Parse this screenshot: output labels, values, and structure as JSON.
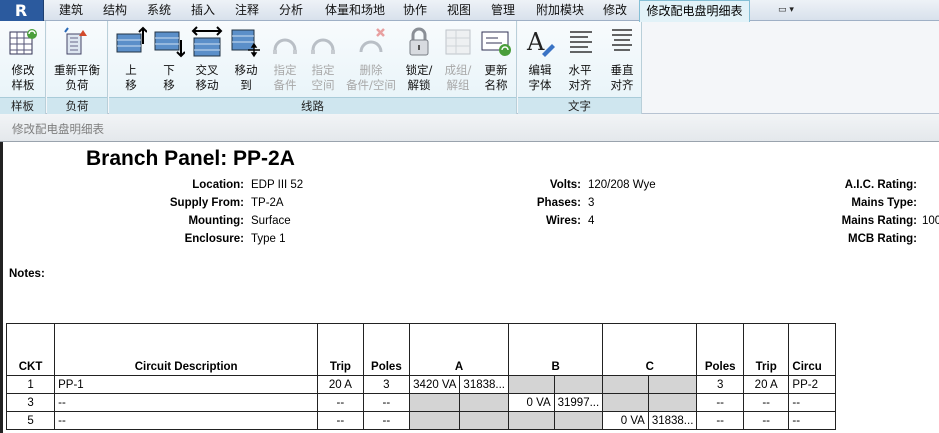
{
  "tabs": [
    "建筑",
    "结构",
    "系统",
    "插入",
    "注释",
    "分析",
    "体量和场地",
    "协作",
    "视图",
    "管理",
    "附加模块",
    "修改",
    "修改配电盘明细表"
  ],
  "tab_extra": "▭ ▾",
  "ribbon": {
    "panels": {
      "template": "样板",
      "load": "负荷",
      "circuits": "线路",
      "text": "文字"
    },
    "buttons": {
      "modify_template": "修改\n样板",
      "rebalance_loads": "重新平衡\n负荷",
      "move_up": "上\n移",
      "move_down": "下\n移",
      "move_across": "交叉\n移动",
      "move_to": "移动\n到",
      "assign_spare": "指定\n备件",
      "assign_space": "指定\n空间",
      "delete_spare_space": "删除\n备件/空间",
      "lock_unlock": "锁定/\n解锁",
      "group_ungroup": "成组/\n解组",
      "update_names": "更新\n名称",
      "edit_font": "编辑\n字体",
      "align_horizontal": "水平\n对齐",
      "align_vertical": "垂直\n对齐"
    }
  },
  "context_bar": "修改配电盘明细表",
  "schedule": {
    "title": "Branch Panel: PP-2A",
    "info_left": [
      {
        "label": "Location:",
        "value": "EDP III 52"
      },
      {
        "label": "Supply From:",
        "value": "TP-2A"
      },
      {
        "label": "Mounting:",
        "value": "Surface"
      },
      {
        "label": "Enclosure:",
        "value": "Type 1"
      }
    ],
    "info_mid": [
      {
        "label": "Volts:",
        "value": "120/208 Wye"
      },
      {
        "label": "Phases:",
        "value": "3"
      },
      {
        "label": "Wires:",
        "value": "4"
      }
    ],
    "info_right": [
      {
        "label": "A.I.C. Rating:",
        "value": ""
      },
      {
        "label": "Mains Type:",
        "value": ""
      },
      {
        "label": "Mains Rating:",
        "value": "100"
      },
      {
        "label": "MCB Rating:",
        "value": ""
      }
    ],
    "notes_label": "Notes:",
    "columns": [
      "CKT",
      "Circuit Description",
      "Trip",
      "Poles",
      "A",
      "B",
      "C",
      "Poles",
      "Trip",
      "Circu"
    ],
    "rows": [
      {
        "ckt": "1",
        "desc": "PP-1",
        "trip": "20 A",
        "poles": "3",
        "a1": "3420 VA",
        "a2": "31838...",
        "b1": "",
        "b2": "",
        "c1": "",
        "c2": "",
        "poles2": "3",
        "trip2": "20 A",
        "desc2": "PP-2"
      },
      {
        "ckt": "3",
        "desc": "--",
        "trip": "--",
        "poles": "--",
        "a1": "",
        "a2": "",
        "b1": "0 VA",
        "b2": "31997...",
        "c1": "",
        "c2": "",
        "poles2": "--",
        "trip2": "--",
        "desc2": "--"
      },
      {
        "ckt": "5",
        "desc": "--",
        "trip": "--",
        "poles": "--",
        "a1": "",
        "a2": "",
        "b1": "",
        "b2": "",
        "c1": "0 VA",
        "c2": "31838...",
        "poles2": "--",
        "trip2": "--",
        "desc2": "--"
      }
    ]
  }
}
